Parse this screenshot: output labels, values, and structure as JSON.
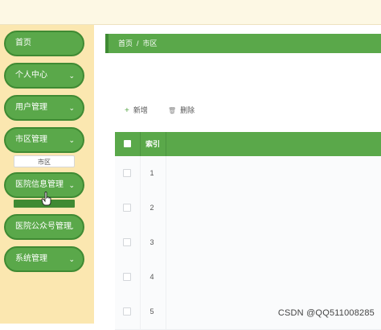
{
  "sidebar": {
    "items": [
      {
        "label": "首页",
        "chevron": ""
      },
      {
        "label": "个人中心",
        "chevron": "⌄"
      },
      {
        "label": "用户管理",
        "chevron": "⌄"
      },
      {
        "label": "市区管理",
        "chevron": "⌄"
      },
      {
        "label": "医院信息管理",
        "chevron": "⌄"
      },
      {
        "label": "医院公众号管理",
        "chevron": "⌄"
      },
      {
        "label": "系统管理",
        "chevron": "⌄"
      }
    ],
    "submenu_label": "市区"
  },
  "breadcrumb": {
    "home": "首页",
    "separator": "/",
    "current": "市区"
  },
  "toolbar": {
    "add_label": "新增",
    "add_icon": "+",
    "delete_label": "删除",
    "delete_icon": "🗑"
  },
  "table": {
    "header_index": "索引",
    "rows": [
      {
        "index": "1"
      },
      {
        "index": "2"
      },
      {
        "index": "3"
      },
      {
        "index": "4"
      },
      {
        "index": "5"
      }
    ]
  },
  "watermark": "CSDN @QQ511008285",
  "colors": {
    "accent": "#5aa84a",
    "sidebar_bg": "#fbe7b0",
    "accent_dark": "#3f8a33"
  }
}
